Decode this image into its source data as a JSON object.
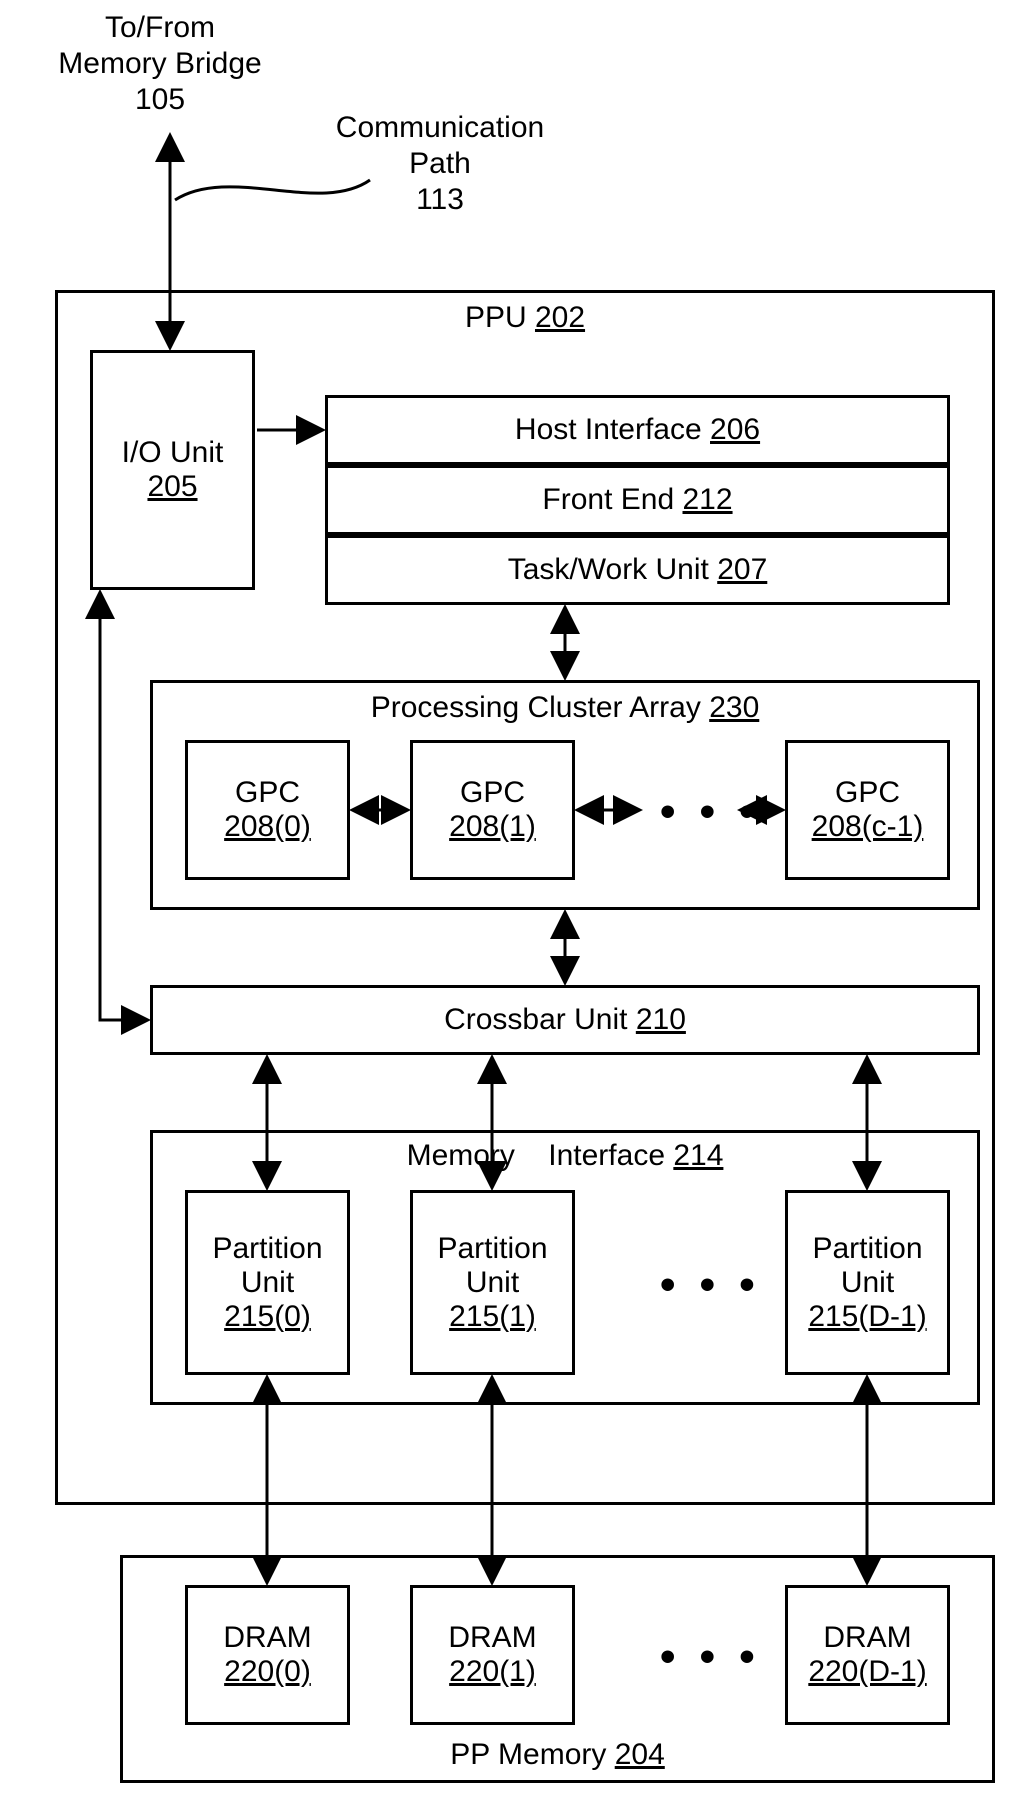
{
  "top": {
    "memory_bridge_line1": "To/From",
    "memory_bridge_line2": "Memory Bridge",
    "memory_bridge_num": "105",
    "comm_path_line1": "Communication",
    "comm_path_line2": "Path",
    "comm_path_num": "113"
  },
  "ppu": {
    "label": "PPU",
    "num": "202",
    "io_unit": {
      "label": "I/O Unit",
      "num": "205"
    },
    "host_interface": {
      "label": "Host Interface",
      "num": "206"
    },
    "front_end": {
      "label": "Front End",
      "num": "212"
    },
    "task_work_unit": {
      "label": "Task/Work Unit",
      "num": "207"
    },
    "pca": {
      "label": "Processing Cluster Array",
      "num": "230",
      "gpc": [
        {
          "label": "GPC",
          "num": "208(0)"
        },
        {
          "label": "GPC",
          "num": "208(1)"
        },
        {
          "label": "GPC",
          "num": "208(c-1)"
        }
      ]
    },
    "crossbar": {
      "label": "Crossbar Unit",
      "num": "210"
    },
    "mem_if": {
      "label": "Memory",
      "label2": "Interface",
      "num": "214",
      "partition": [
        {
          "line1": "Partition",
          "line2": "Unit",
          "num": "215(0)"
        },
        {
          "line1": "Partition",
          "line2": "Unit",
          "num": "215(1)"
        },
        {
          "line1": "Partition",
          "line2": "Unit",
          "num": "215(D-1)"
        }
      ]
    }
  },
  "pp_memory": {
    "label": "PP Memory",
    "num": "204",
    "dram": [
      {
        "label": "DRAM",
        "num": "220(0)"
      },
      {
        "label": "DRAM",
        "num": "220(1)"
      },
      {
        "label": "DRAM",
        "num": "220(D-1)"
      }
    ]
  },
  "ellipsis": "• • •"
}
